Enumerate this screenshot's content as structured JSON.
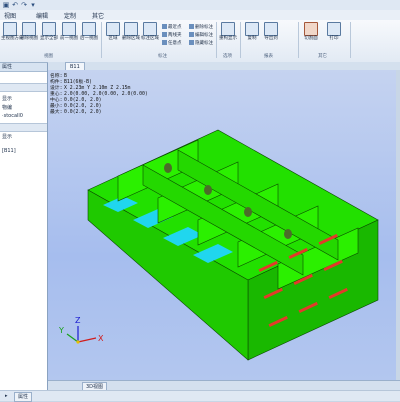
{
  "app": {
    "quick_access": [
      "▣",
      "↶",
      "↷",
      "▾"
    ],
    "menus": [
      "视图",
      "编辑",
      "定制",
      "其它"
    ]
  },
  "ribbon": {
    "buttons": [
      {
        "label": "主视图方向"
      },
      {
        "label": "删除视图"
      },
      {
        "label": "显示全部"
      },
      {
        "label": "前一视图"
      },
      {
        "label": "后一视图"
      },
      {
        "label": "区域"
      },
      {
        "label": "删除区域"
      },
      {
        "label": "标注区域"
      },
      {
        "label": "重构显示"
      },
      {
        "label": "复制"
      },
      {
        "label": "导出到"
      },
      {
        "label": "切割面"
      },
      {
        "label": "打印"
      }
    ],
    "small": [
      "最近点",
      "两线夹",
      "任意点",
      "删除标注",
      "编辑标注",
      "隐藏标注"
    ],
    "groups": [
      "视图",
      "标注",
      "选项",
      "报表",
      "其它"
    ]
  },
  "left_panel": {
    "header": "属性",
    "rows": [
      "显示",
      "物编",
      "·stocall0",
      "显示",
      "[B11]"
    ]
  },
  "tab": {
    "label": "B11"
  },
  "viewport": {
    "info": [
      {
        "k": "名称:",
        "v": "B"
      },
      {
        "k": "构件:",
        "v": "B11(6板-B)"
      },
      {
        "k": "设计:",
        "v": "X 2.23m  Y 2.10m  Z 2.15m"
      },
      {
        "k": "重心:",
        "v": "2.0(0.00, 2.0(0.00, 2.0(0.00)"
      },
      {
        "k": "中心:",
        "v": "0.0(2.0, 2.0)"
      },
      {
        "k": "最小:",
        "v": "0.0(2.0, 2.0)"
      },
      {
        "k": "最大:",
        "v": "0.0(2.0, 2.0)"
      }
    ],
    "axes": {
      "x": "X",
      "y": "Y",
      "z": "Z"
    }
  },
  "bottom": {
    "tabs": [
      "3D视图"
    ]
  },
  "status": {
    "left": [
      "▸",
      "属性"
    ]
  },
  "colors": {
    "hull": "#22e000",
    "edge": "#0b4a00",
    "web": "#e23a2a",
    "floor": "#20d6ee"
  }
}
